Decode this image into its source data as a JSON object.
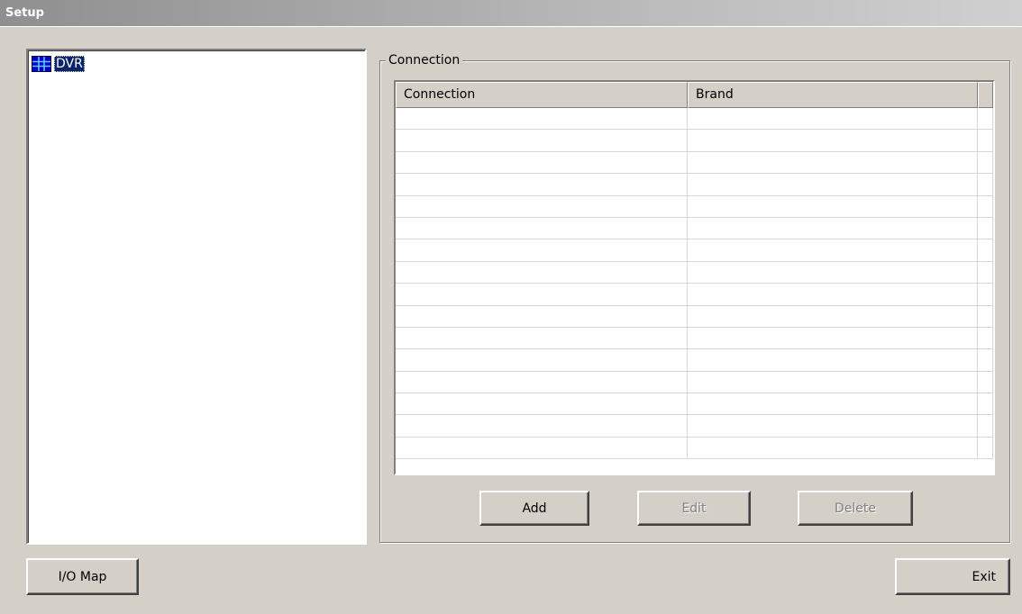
{
  "window": {
    "title": "Setup"
  },
  "tree": {
    "items": [
      {
        "label": "DVR",
        "icon": "dvr-grid-icon",
        "selected": true
      }
    ]
  },
  "connection_group": {
    "legend": "Connection",
    "table": {
      "columns": [
        "Connection",
        "Brand"
      ],
      "rows": []
    },
    "buttons": {
      "add": "Add",
      "edit": "Edit",
      "delete": "Delete"
    },
    "disabled": {
      "edit": true,
      "delete": true
    }
  },
  "footer": {
    "io_map": "I/O Map",
    "exit": "Exit"
  },
  "colors": {
    "selection": "#0a246a",
    "icon_blue": "#0000cc",
    "face": "#d4d0c8"
  }
}
